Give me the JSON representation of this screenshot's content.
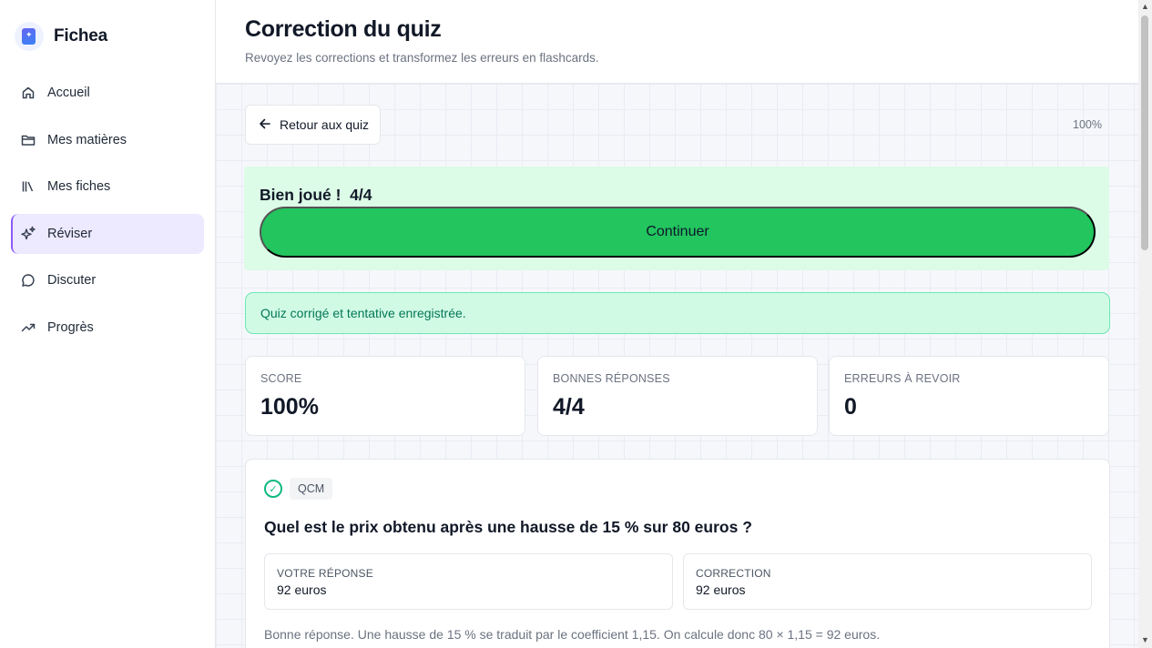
{
  "app": {
    "name": "Fichea"
  },
  "sidebar": {
    "items": [
      {
        "label": "Accueil",
        "icon": "home-icon",
        "active": false
      },
      {
        "label": "Mes matières",
        "icon": "folder-icon",
        "active": false
      },
      {
        "label": "Mes fiches",
        "icon": "books-icon",
        "active": false
      },
      {
        "label": "Réviser",
        "icon": "sparkles-icon",
        "active": true
      },
      {
        "label": "Discuter",
        "icon": "chat-bubble-icon",
        "active": false
      },
      {
        "label": "Progrès",
        "icon": "trending-up-icon",
        "active": false
      }
    ]
  },
  "header": {
    "title": "Correction du quiz",
    "subtitle": "Revoyez les corrections et transformez les erreurs en flashcards."
  },
  "toolbar": {
    "back_label": "Retour aux quiz",
    "progress": "100%"
  },
  "result": {
    "title": "Bien joué !  4/4",
    "continue_label": "Continuer"
  },
  "alert": {
    "message": "Quiz corrigé et tentative enregistrée."
  },
  "stats": [
    {
      "label": "SCORE",
      "value": "100%"
    },
    {
      "label": "BONNES RÉPONSES",
      "value": "4/4"
    },
    {
      "label": "ERREURS À REVOIR",
      "value": "0"
    }
  ],
  "question": {
    "type": "QCM",
    "status": "correct",
    "text": "Quel est le prix obtenu après une hausse de 15 % sur 80 euros ?",
    "your_answer_label": "VOTRE RÉPONSE",
    "your_answer": "92 euros",
    "correction_label": "CORRECTION",
    "correction": "92 euros",
    "explanation": "Bonne réponse. Une hausse de 15 % se traduit par le coefficient 1,15. On calcule donc 80 × 1,15 = 92 euros."
  },
  "colors": {
    "accent": "#8b5cf6",
    "success": "#22c55e",
    "success_bg": "#dcfce7",
    "alert_bg": "#d1fae5",
    "alert_text": "#047857"
  }
}
